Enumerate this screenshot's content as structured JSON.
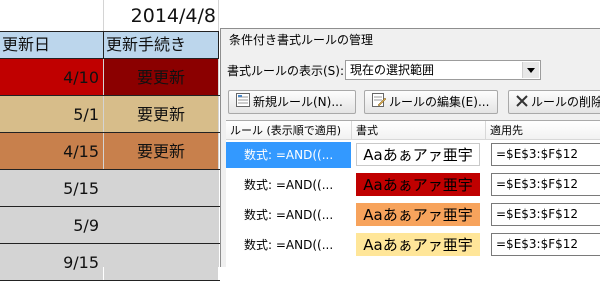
{
  "sheet": {
    "top_date": "2014/4/8",
    "headers": {
      "col_d": "更新日",
      "col_e": "更新手続き"
    },
    "rows": [
      {
        "date": "4/10",
        "action": "要更新",
        "fill": "#c00000",
        "action_fill": "#8b0000"
      },
      {
        "date": "5/1",
        "action": "要更新",
        "fill": "#d7bd8a",
        "action_fill": "#d7bd8a"
      },
      {
        "date": "4/15",
        "action": "要更新",
        "fill": "#c8804c",
        "action_fill": "#c8804c"
      },
      {
        "date": "5/15",
        "action": "",
        "fill": "#d4d4d4",
        "action_fill": "#d4d4d4"
      },
      {
        "date": "5/9",
        "action": "",
        "fill": "#d4d4d4",
        "action_fill": "#d4d4d4"
      },
      {
        "date": "9/15",
        "action": "",
        "fill": "#d4d4d4",
        "action_fill": "#d4d4d4"
      }
    ]
  },
  "dialog": {
    "title": "条件付き書式ルールの管理",
    "show_rules_label": "書式ルールの表示(S):",
    "show_rules_value": "現在の選択範囲",
    "buttons": {
      "new_rule": "新規ルール(N)...",
      "edit_rule": "ルールの編集(E)...",
      "delete_rule": "ルールの削除"
    },
    "columns": {
      "rule": "ルール (表示順で適用)",
      "format": "書式",
      "applies_to": "適用先"
    },
    "rules": [
      {
        "rule": "数式: =AND((...",
        "sample": "Aaあぁアァ亜宇",
        "sample_bg": "#ffffff",
        "sample_border": "#c9c9c9",
        "applies_to": "=$E$3:$F$12",
        "selected": true
      },
      {
        "rule": "数式: =AND((...",
        "sample": "Aaあぁアァ亜宇",
        "sample_bg": "#c00000",
        "sample_border": "#c00000",
        "applies_to": "=$E$3:$F$12",
        "selected": false
      },
      {
        "rule": "数式: =AND((...",
        "sample": "Aaあぁアァ亜宇",
        "sample_bg": "#f7a35c",
        "sample_border": "#f7a35c",
        "applies_to": "=$E$3:$F$12",
        "selected": false
      },
      {
        "rule": "数式: =AND((...",
        "sample": "Aaあぁアァ亜宇",
        "sample_bg": "#ffe699",
        "sample_border": "#ffe699",
        "applies_to": "=$E$3:$F$12",
        "selected": false
      }
    ],
    "icons": {
      "new": "new-rule-icon",
      "edit": "edit-rule-icon",
      "delete": "delete-x-icon",
      "dropdown": "chevron-down-icon"
    }
  }
}
